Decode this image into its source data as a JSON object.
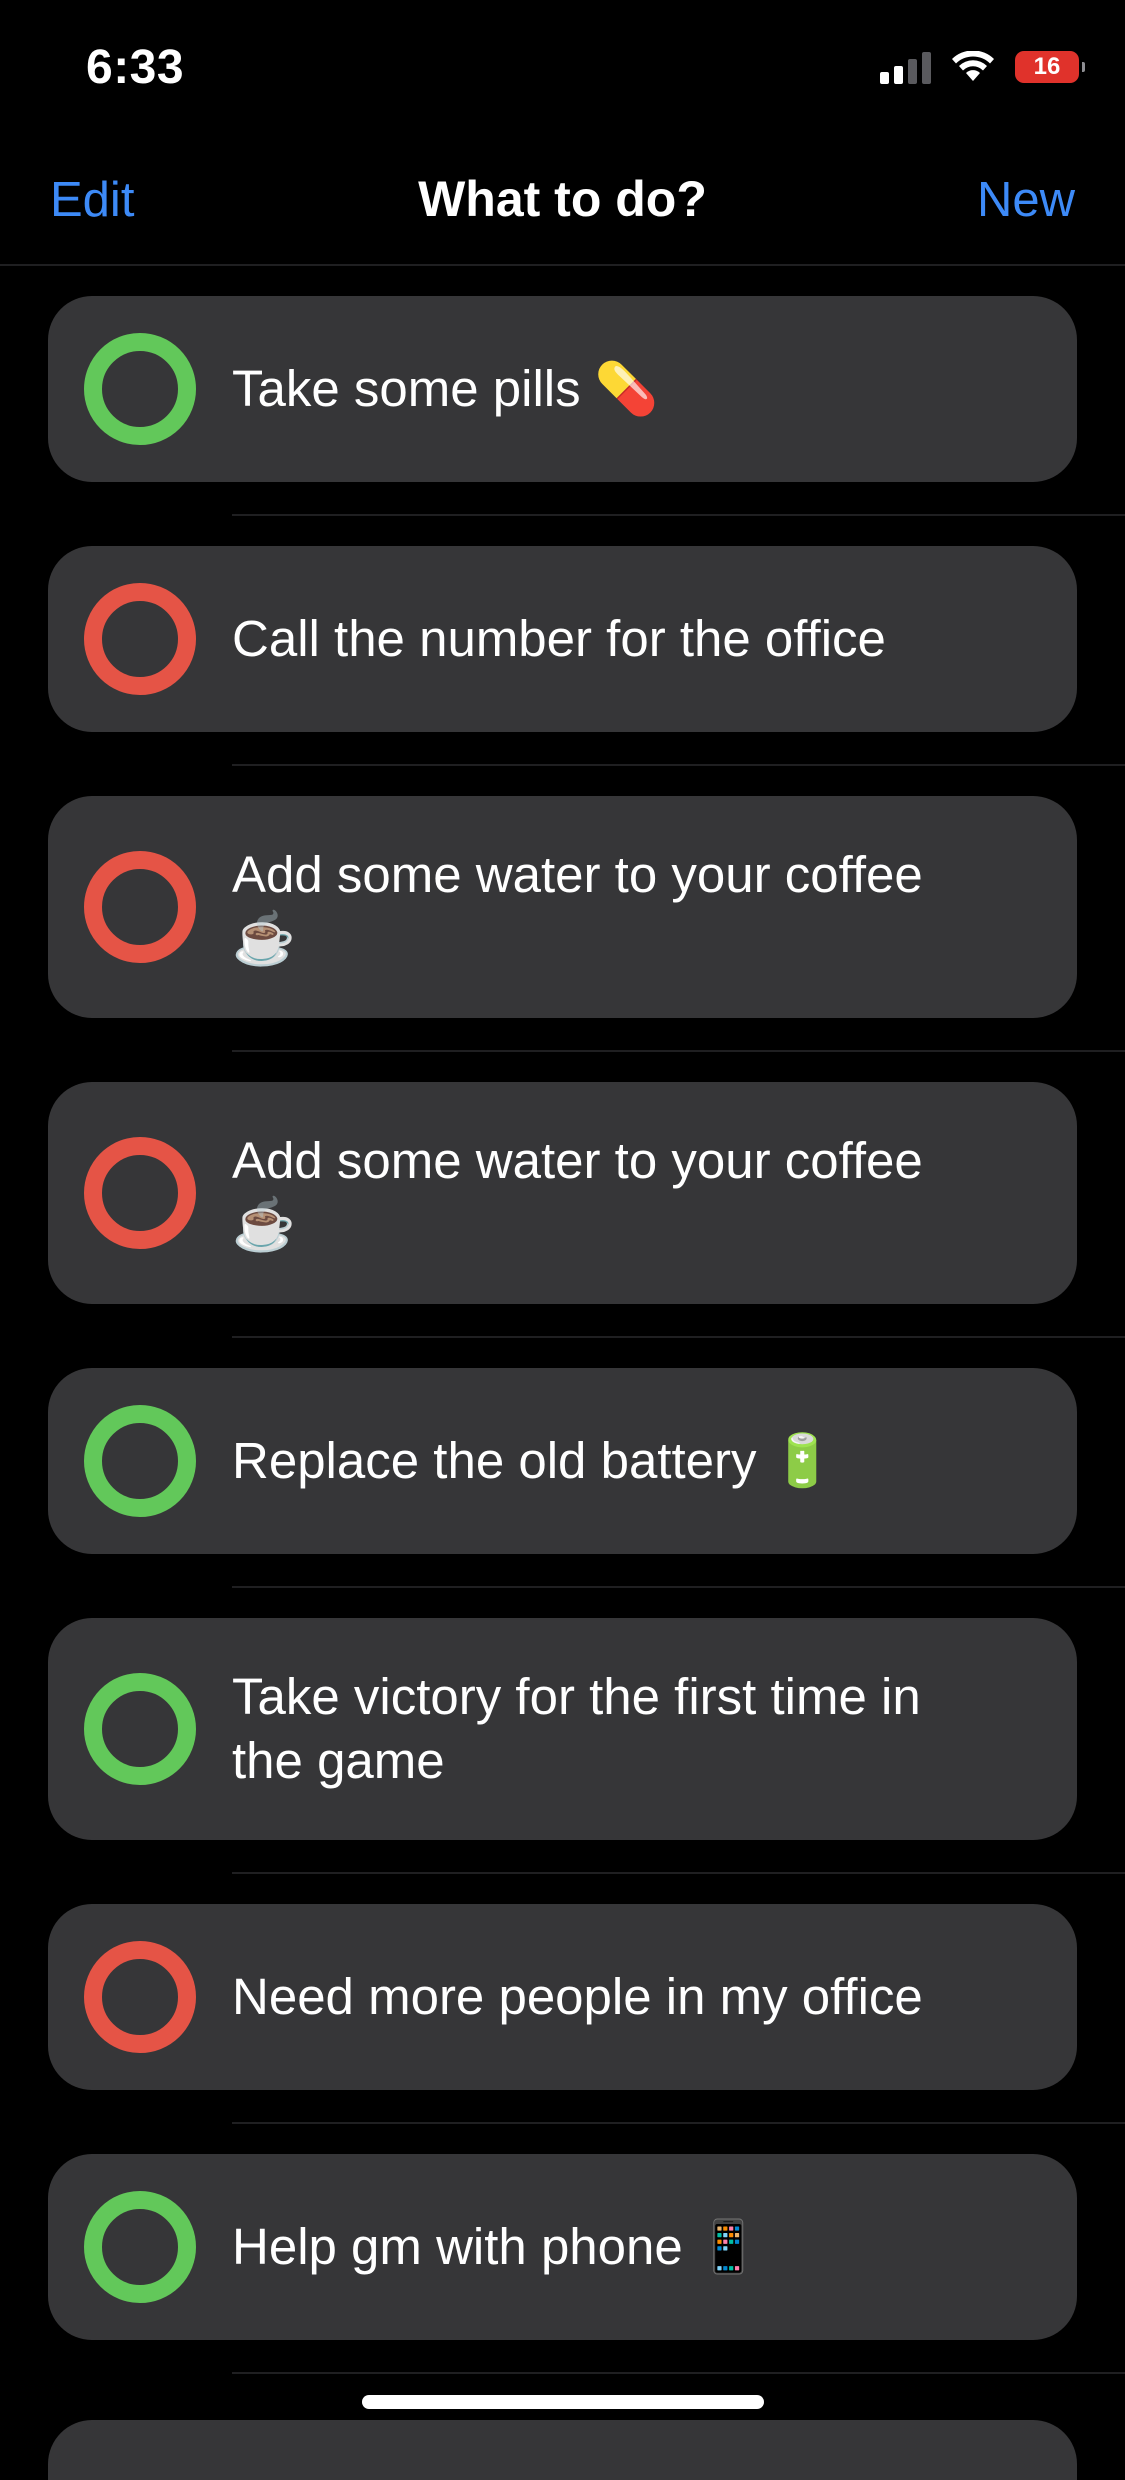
{
  "status_bar": {
    "time": "6:33",
    "battery_level": "16",
    "icons": [
      "signal-icon",
      "wifi-icon",
      "battery-charging-icon"
    ]
  },
  "nav": {
    "edit_label": "Edit",
    "title": "What to do?",
    "new_label": "New"
  },
  "colors": {
    "accent": "#3d8af7",
    "done_green": "#62c85a",
    "pending_red": "#e55446",
    "card_bg": "#363638"
  },
  "tasks": [
    {
      "text": "Take some pills 💊",
      "status": "green"
    },
    {
      "text": "Call the number for the office",
      "status": "red"
    },
    {
      "text": "Add some water to your coffee ☕️",
      "status": "red"
    },
    {
      "text": "Add some water to your coffee ☕️",
      "status": "red"
    },
    {
      "text": "Replace the old battery 🔋",
      "status": "green"
    },
    {
      "text": "Take victory for the first time in the game",
      "status": "green"
    },
    {
      "text": "Need more people in my office",
      "status": "red"
    },
    {
      "text": "Help gm with phone 📱",
      "status": "green"
    }
  ]
}
